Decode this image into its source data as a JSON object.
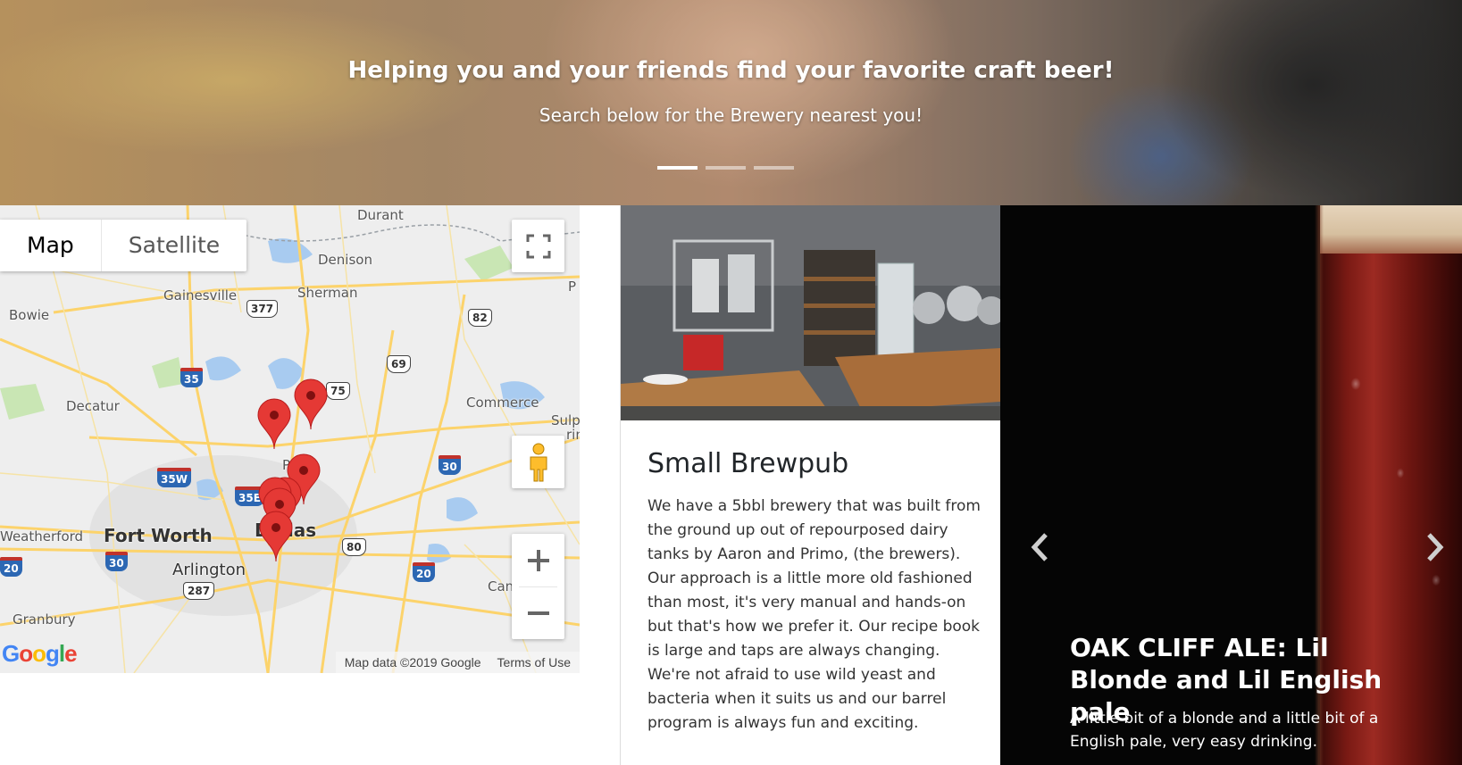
{
  "hero": {
    "title": "Helping you and your friends find your favorite craft beer!",
    "subtitle": "Search below for the Brewery nearest you!",
    "indicators": [
      "slide-1",
      "slide-2",
      "slide-3"
    ],
    "active_indicator": 1
  },
  "map": {
    "type_controls": {
      "map": "Map",
      "satellite": "Satellite"
    },
    "labels": {
      "durant": "Durant",
      "denison": "Denison",
      "gainesville": "Gainesville",
      "sherman": "Sherman",
      "bowie": "Bowie",
      "decatur": "Decatur",
      "commerce": "Commerce",
      "sulphur": "Sulp",
      "sulphur2": "rin",
      "plano": "Plano",
      "weatherford": "Weatherford",
      "fort_worth": "Fort Worth",
      "dallas": "Dallas",
      "arlington": "Arlington",
      "granbury": "Granbury",
      "canton": "Can",
      "paris": "P"
    },
    "shields": {
      "i35": "35",
      "i35w": "35W",
      "i35e": "35E",
      "i30_west": "30",
      "i30_east": "30",
      "i20_west": "20",
      "i20_east": "20",
      "us377": "377",
      "us82": "82",
      "us69": "69",
      "us75": "75",
      "us80": "80",
      "us287": "287"
    },
    "footer": {
      "data": "Map data ©2019 Google",
      "terms": "Terms of Use"
    },
    "logo": "Google",
    "marker_count": 7,
    "marker_color": "#e53935"
  },
  "card": {
    "title": "Small Brewpub",
    "text": "We have a 5bbl brewery that was built from the ground up out of repourposed dairy tanks by Aaron and Primo, (the brewers). Our approach is a little more old fashioned than most, it's very manual and hands-on but that's how we prefer it. Our recipe book is large and taps are always changing. We're not afraid to use wild yeast and bacteria when it suits us and our barrel program is always fun and exciting."
  },
  "beer_slide": {
    "title": "OAK CLIFF ALE: Lil Blonde and Lil English pale",
    "text": "A little bit of a blonde and a little bit of a English pale, very easy drinking.",
    "prev_icon": "chevron-left-icon",
    "next_icon": "chevron-right-icon"
  },
  "colors": {
    "interstate": "#2c67b3",
    "road": "#fcd36b",
    "water": "#a8cbf0",
    "marker": "#e53935"
  }
}
